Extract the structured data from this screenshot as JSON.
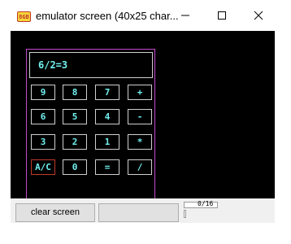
{
  "window": {
    "title": "emulator screen (40x25 char...",
    "icon_label": "8GB",
    "controls": {
      "minimize": "minimize-icon",
      "maximize": "maximize-icon",
      "close": "close-icon"
    }
  },
  "calculator": {
    "display": "6/2=3",
    "keys": [
      [
        "9",
        "8",
        "7",
        "+"
      ],
      [
        "6",
        "5",
        "4",
        "-"
      ],
      [
        "3",
        "2",
        "1",
        "*"
      ],
      [
        "A/C",
        "0",
        "=",
        "/"
      ]
    ]
  },
  "bottom": {
    "clear_button": "clear screen",
    "blank_button": "",
    "counter": "0/16"
  },
  "colors": {
    "screen_bg": "#000000",
    "calc_text": "#70f0ee",
    "frame": "#c34ac9",
    "clear_key_border": "#c0392b"
  }
}
